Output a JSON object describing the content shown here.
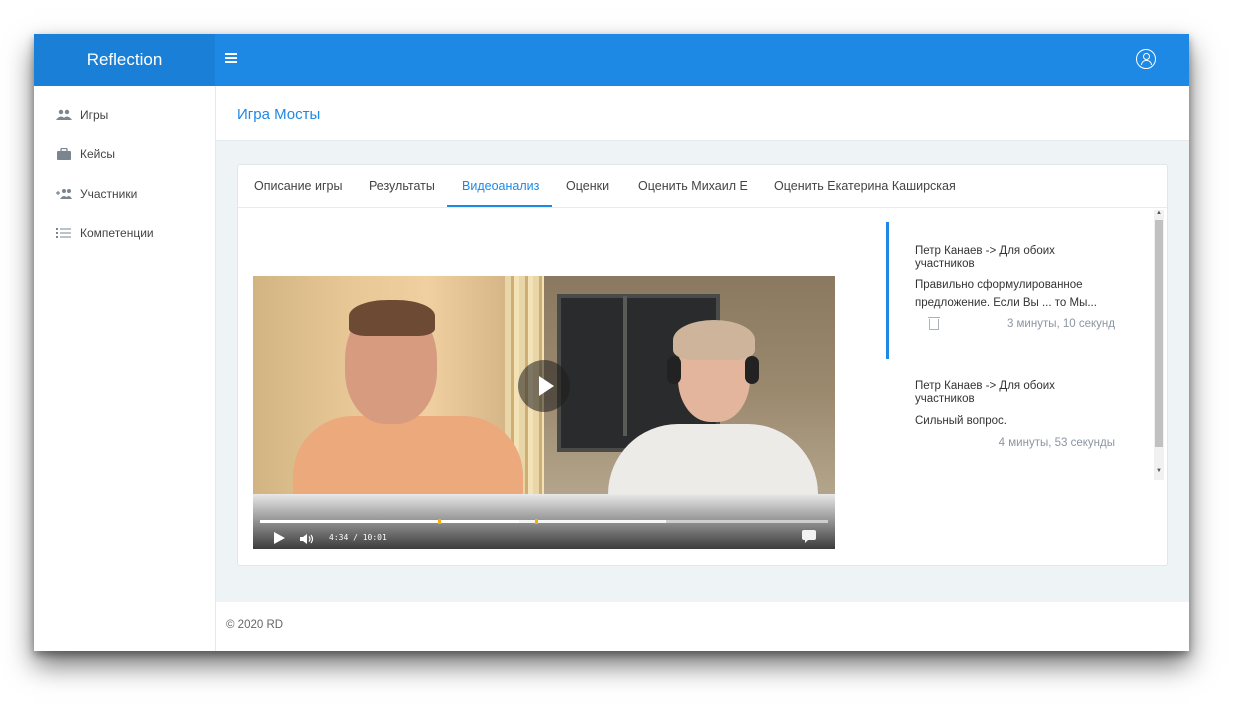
{
  "app": {
    "brand": "Reflection"
  },
  "sidebar": {
    "items": [
      {
        "label": "Игры",
        "icon": "users-icon"
      },
      {
        "label": "Кейсы",
        "icon": "briefcase-icon"
      },
      {
        "label": "Участники",
        "icon": "add-user-icon"
      },
      {
        "label": "Компетенции",
        "icon": "list-icon"
      }
    ]
  },
  "page": {
    "title": "Игра Мосты"
  },
  "tabs": [
    {
      "label": "Описание игры"
    },
    {
      "label": "Результаты"
    },
    {
      "label": "Видеоанализ"
    },
    {
      "label": "Оценки"
    },
    {
      "label": "Оценить Михаил Е"
    },
    {
      "label": "Оценить Екатерина Каширская"
    }
  ],
  "active_tab": "Видеоанализ",
  "video": {
    "time_display": "4:34 / 10:01",
    "current_time": "4:34",
    "duration": "10:01",
    "played_fraction": 0.456,
    "buffered_fraction": 0.715
  },
  "comments": [
    {
      "author": "Петр Канаев -> Для обоих участников",
      "text": "Правильно сформулированное предложение. Если Вы ... то Мы...",
      "time": "3 минуты, 10 секунд"
    },
    {
      "author": "Петр Канаев -> Для обоих участников",
      "text": "Сильный вопрос.",
      "time": "4 минуты, 53 секунды"
    }
  ],
  "footer": {
    "text": "© 2020 RD"
  },
  "colors": {
    "accent": "#1e88e5",
    "marker": "#f0b400",
    "background": "#eef3f6"
  }
}
